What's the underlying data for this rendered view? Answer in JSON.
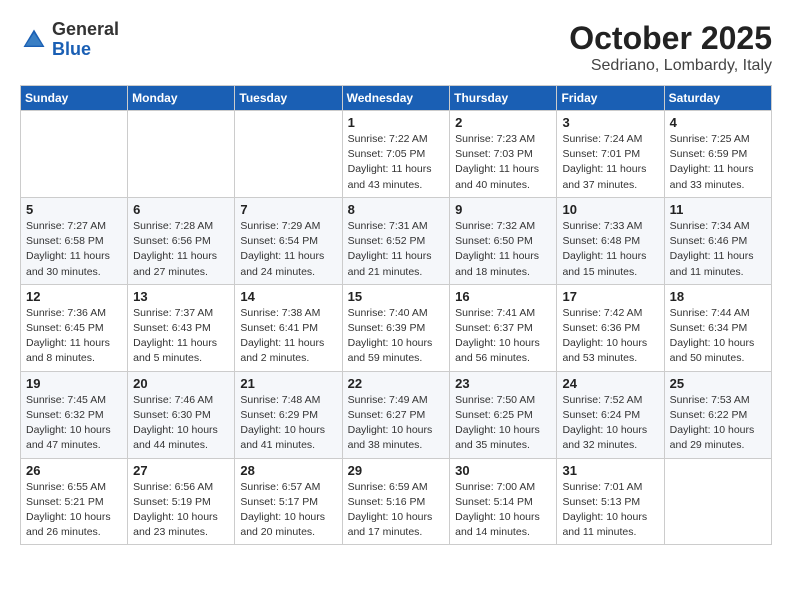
{
  "header": {
    "logo_general": "General",
    "logo_blue": "Blue",
    "month": "October 2025",
    "location": "Sedriano, Lombardy, Italy"
  },
  "weekdays": [
    "Sunday",
    "Monday",
    "Tuesday",
    "Wednesday",
    "Thursday",
    "Friday",
    "Saturday"
  ],
  "weeks": [
    [
      {
        "day": "",
        "info": ""
      },
      {
        "day": "",
        "info": ""
      },
      {
        "day": "",
        "info": ""
      },
      {
        "day": "1",
        "info": "Sunrise: 7:22 AM\nSunset: 7:05 PM\nDaylight: 11 hours and 43 minutes."
      },
      {
        "day": "2",
        "info": "Sunrise: 7:23 AM\nSunset: 7:03 PM\nDaylight: 11 hours and 40 minutes."
      },
      {
        "day": "3",
        "info": "Sunrise: 7:24 AM\nSunset: 7:01 PM\nDaylight: 11 hours and 37 minutes."
      },
      {
        "day": "4",
        "info": "Sunrise: 7:25 AM\nSunset: 6:59 PM\nDaylight: 11 hours and 33 minutes."
      }
    ],
    [
      {
        "day": "5",
        "info": "Sunrise: 7:27 AM\nSunset: 6:58 PM\nDaylight: 11 hours and 30 minutes."
      },
      {
        "day": "6",
        "info": "Sunrise: 7:28 AM\nSunset: 6:56 PM\nDaylight: 11 hours and 27 minutes."
      },
      {
        "day": "7",
        "info": "Sunrise: 7:29 AM\nSunset: 6:54 PM\nDaylight: 11 hours and 24 minutes."
      },
      {
        "day": "8",
        "info": "Sunrise: 7:31 AM\nSunset: 6:52 PM\nDaylight: 11 hours and 21 minutes."
      },
      {
        "day": "9",
        "info": "Sunrise: 7:32 AM\nSunset: 6:50 PM\nDaylight: 11 hours and 18 minutes."
      },
      {
        "day": "10",
        "info": "Sunrise: 7:33 AM\nSunset: 6:48 PM\nDaylight: 11 hours and 15 minutes."
      },
      {
        "day": "11",
        "info": "Sunrise: 7:34 AM\nSunset: 6:46 PM\nDaylight: 11 hours and 11 minutes."
      }
    ],
    [
      {
        "day": "12",
        "info": "Sunrise: 7:36 AM\nSunset: 6:45 PM\nDaylight: 11 hours and 8 minutes."
      },
      {
        "day": "13",
        "info": "Sunrise: 7:37 AM\nSunset: 6:43 PM\nDaylight: 11 hours and 5 minutes."
      },
      {
        "day": "14",
        "info": "Sunrise: 7:38 AM\nSunset: 6:41 PM\nDaylight: 11 hours and 2 minutes."
      },
      {
        "day": "15",
        "info": "Sunrise: 7:40 AM\nSunset: 6:39 PM\nDaylight: 10 hours and 59 minutes."
      },
      {
        "day": "16",
        "info": "Sunrise: 7:41 AM\nSunset: 6:37 PM\nDaylight: 10 hours and 56 minutes."
      },
      {
        "day": "17",
        "info": "Sunrise: 7:42 AM\nSunset: 6:36 PM\nDaylight: 10 hours and 53 minutes."
      },
      {
        "day": "18",
        "info": "Sunrise: 7:44 AM\nSunset: 6:34 PM\nDaylight: 10 hours and 50 minutes."
      }
    ],
    [
      {
        "day": "19",
        "info": "Sunrise: 7:45 AM\nSunset: 6:32 PM\nDaylight: 10 hours and 47 minutes."
      },
      {
        "day": "20",
        "info": "Sunrise: 7:46 AM\nSunset: 6:30 PM\nDaylight: 10 hours and 44 minutes."
      },
      {
        "day": "21",
        "info": "Sunrise: 7:48 AM\nSunset: 6:29 PM\nDaylight: 10 hours and 41 minutes."
      },
      {
        "day": "22",
        "info": "Sunrise: 7:49 AM\nSunset: 6:27 PM\nDaylight: 10 hours and 38 minutes."
      },
      {
        "day": "23",
        "info": "Sunrise: 7:50 AM\nSunset: 6:25 PM\nDaylight: 10 hours and 35 minutes."
      },
      {
        "day": "24",
        "info": "Sunrise: 7:52 AM\nSunset: 6:24 PM\nDaylight: 10 hours and 32 minutes."
      },
      {
        "day": "25",
        "info": "Sunrise: 7:53 AM\nSunset: 6:22 PM\nDaylight: 10 hours and 29 minutes."
      }
    ],
    [
      {
        "day": "26",
        "info": "Sunrise: 6:55 AM\nSunset: 5:21 PM\nDaylight: 10 hours and 26 minutes."
      },
      {
        "day": "27",
        "info": "Sunrise: 6:56 AM\nSunset: 5:19 PM\nDaylight: 10 hours and 23 minutes."
      },
      {
        "day": "28",
        "info": "Sunrise: 6:57 AM\nSunset: 5:17 PM\nDaylight: 10 hours and 20 minutes."
      },
      {
        "day": "29",
        "info": "Sunrise: 6:59 AM\nSunset: 5:16 PM\nDaylight: 10 hours and 17 minutes."
      },
      {
        "day": "30",
        "info": "Sunrise: 7:00 AM\nSunset: 5:14 PM\nDaylight: 10 hours and 14 minutes."
      },
      {
        "day": "31",
        "info": "Sunrise: 7:01 AM\nSunset: 5:13 PM\nDaylight: 10 hours and 11 minutes."
      },
      {
        "day": "",
        "info": ""
      }
    ]
  ]
}
